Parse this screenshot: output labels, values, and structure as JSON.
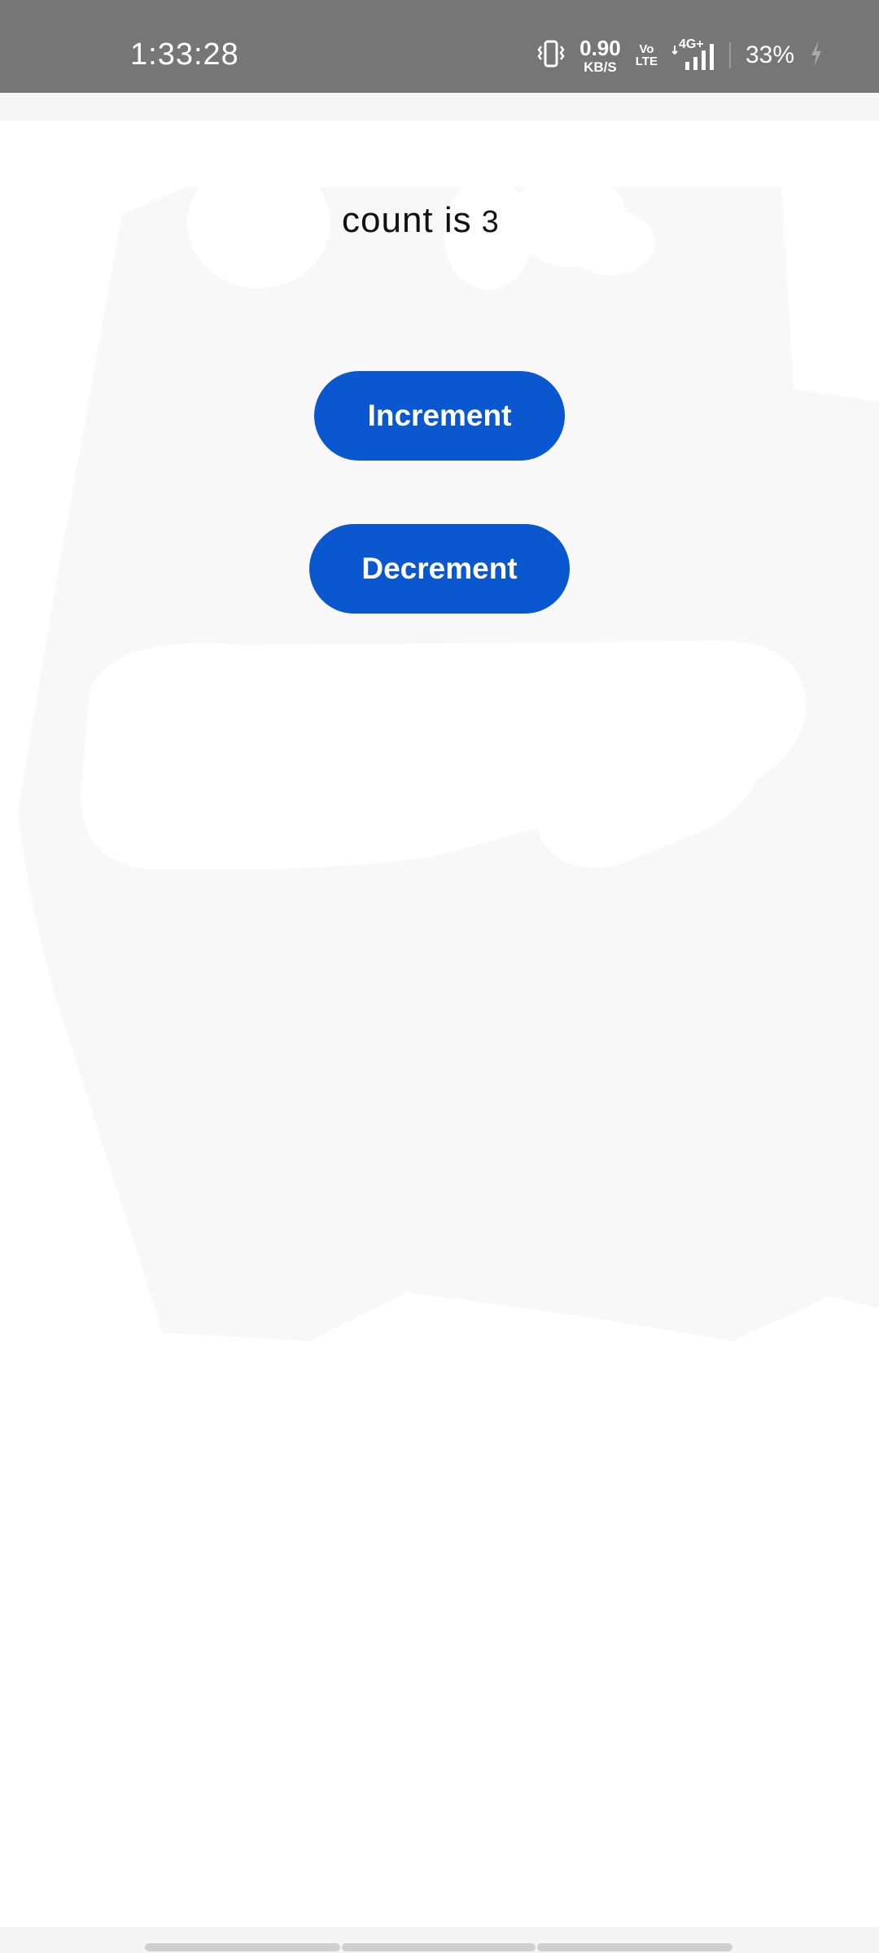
{
  "status_bar": {
    "time": "1:33:28",
    "net_speed_value": "0.90",
    "net_speed_unit": "KB/S",
    "volte_top": "Vo",
    "volte_bottom": "LTE",
    "network": "4G+",
    "battery_percent": "33%",
    "icons": [
      "vibrate-icon",
      "signal-icon",
      "charging-icon"
    ]
  },
  "counter": {
    "label": "count is",
    "value": "3"
  },
  "buttons": {
    "increment_label": "Increment",
    "decrement_label": "Decrement"
  },
  "colors": {
    "status_bar_bg": "#767676",
    "button_bg": "#0b57d0",
    "button_text": "#ffffff",
    "page_bg": "#ffffff"
  }
}
